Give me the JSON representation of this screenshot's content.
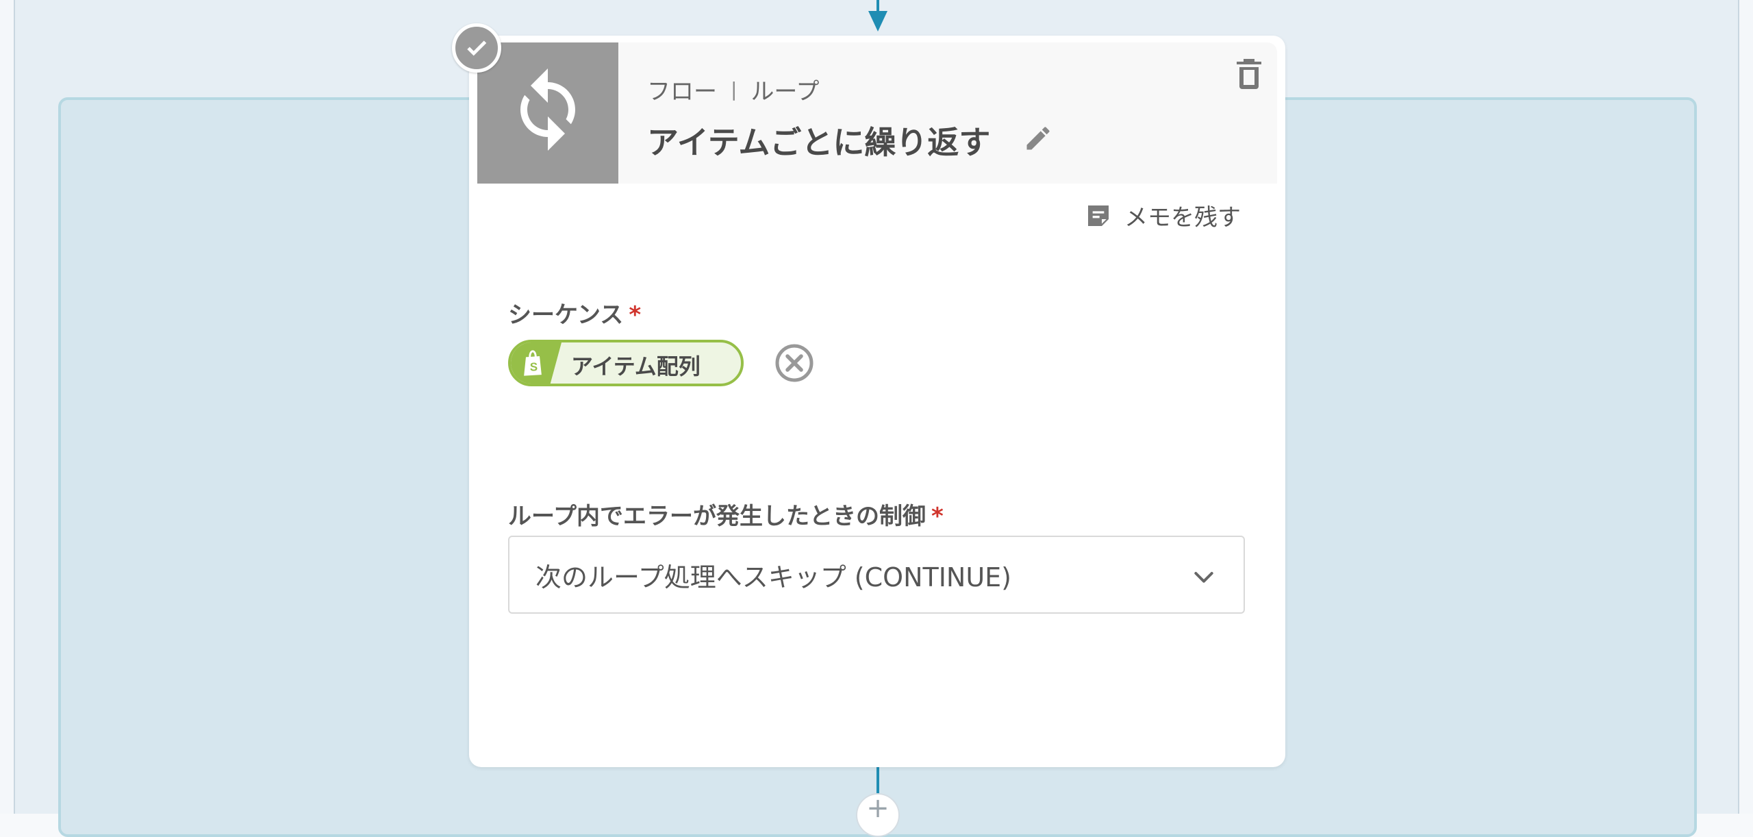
{
  "node": {
    "breadcrumb_category": "フロー",
    "breadcrumb_separator": "|",
    "breadcrumb_type": "ループ",
    "title": "アイテムごとに繰り返す",
    "memo_label": "メモを残す"
  },
  "fields": {
    "sequence": {
      "label": "シーケンス",
      "required_mark": "*",
      "chip_label": "アイテム配列",
      "chip_color": "#96bf48"
    },
    "error_control": {
      "label": "ループ内でエラーが発生したときの制御",
      "required_mark": "*",
      "selected_option": "次のループ処理へスキップ (CONTINUE)"
    }
  },
  "canvas": {
    "add_node_label": "+",
    "connector_color": "#1f8db3"
  },
  "icons": {
    "node_icon": "loop-sync-icon",
    "status_badge": "check-icon",
    "delete": "trash-icon",
    "edit": "pencil-icon",
    "memo": "note-icon",
    "chip_logo": "shopify-bag-icon",
    "chip_remove": "close-circle-icon",
    "select": "chevron-down-icon"
  }
}
